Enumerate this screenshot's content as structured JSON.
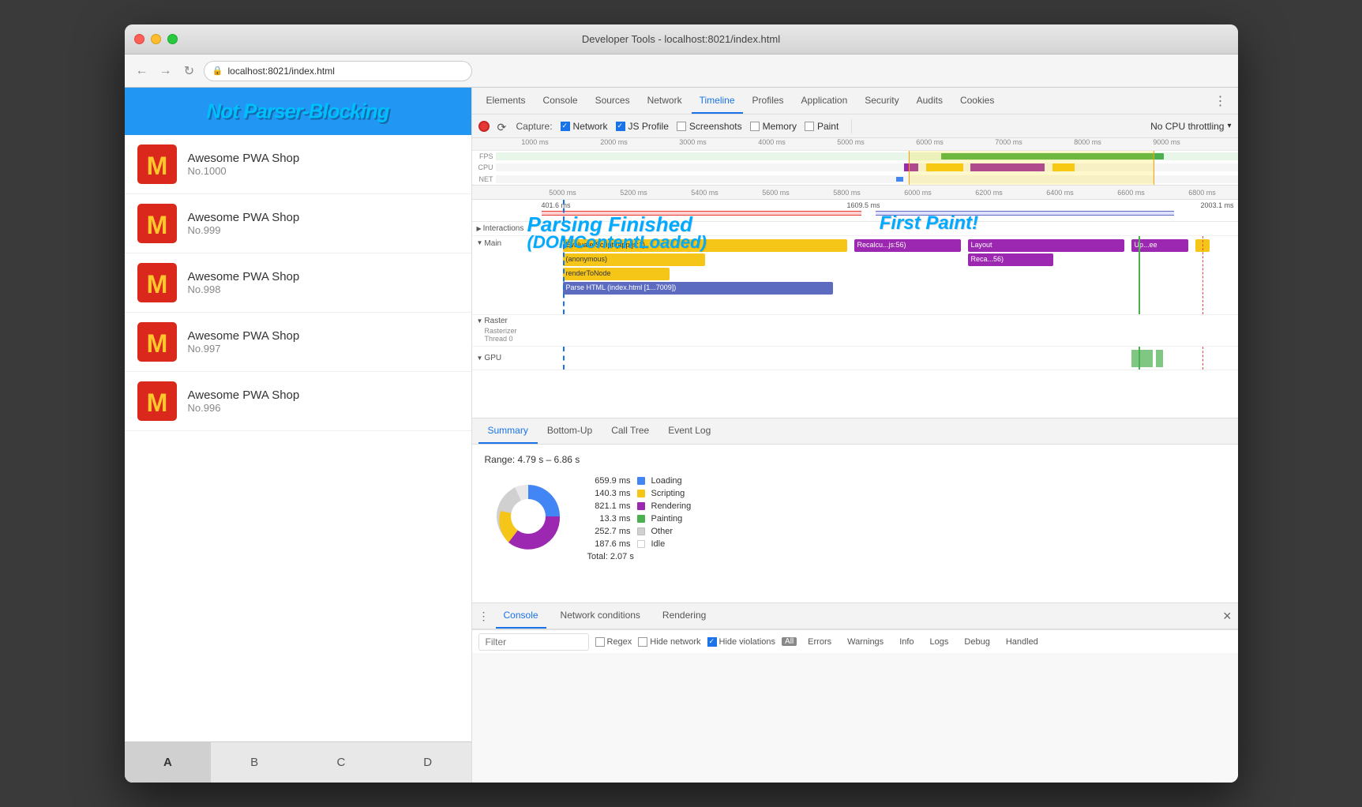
{
  "window": {
    "title": "Developer Tools - localhost:8021/index.html",
    "traffic_lights": [
      "close",
      "minimize",
      "maximize"
    ]
  },
  "browser": {
    "url": "localhost:8021/index.html",
    "back_label": "←",
    "forward_label": "→",
    "reload_label": "↻"
  },
  "webpage": {
    "header_annotation": "Not Parser-Blocking",
    "shop_items": [
      {
        "name": "Awesome PWA Shop",
        "number": "No.1000"
      },
      {
        "name": "Awesome PWA Shop",
        "number": "No.999"
      },
      {
        "name": "Awesome PWA Shop",
        "number": "No.998"
      },
      {
        "name": "Awesome PWA Shop",
        "number": "No.997"
      },
      {
        "name": "Awesome PWA Shop",
        "number": "No.996"
      }
    ],
    "tabs": [
      "A",
      "B",
      "C",
      "D"
    ],
    "active_tab": "A"
  },
  "devtools": {
    "tabs": [
      "Elements",
      "Console",
      "Sources",
      "Network",
      "Timeline",
      "Profiles",
      "Application",
      "Security",
      "Audits",
      "Cookies"
    ],
    "active_tab": "Timeline",
    "more_label": "⋮",
    "capture": {
      "label": "Capture:",
      "options": [
        "Network",
        "JS Profile",
        "Screenshots",
        "Memory",
        "Paint"
      ],
      "checked": [
        "Network",
        "JS Profile",
        "Hide violations"
      ]
    },
    "cpu_throttle": "No CPU throttling",
    "scale_marks": [
      "1000 ms",
      "2000 ms",
      "3000 ms",
      "4000 ms",
      "5000 ms",
      "6000 ms",
      "7000 ms",
      "8000 ms",
      "9000 ms"
    ],
    "detail_scale_marks": [
      "5000 ms",
      "5200 ms",
      "5400 ms",
      "5600 ms",
      "5800 ms",
      "6000 ms",
      "6200 ms",
      "6400 ms",
      "6600 ms",
      "6800 ms"
    ],
    "timing_bars": {
      "top_label": "401.6 ms",
      "mid_label": "1609.5 ms",
      "bottom_label": "2003.1 ms"
    },
    "interactions_label": "Interactions",
    "main_label": "Main",
    "raster_label": "Raster",
    "rasterizer_label": "Rasterizer Thread 0",
    "gpu_label": "GPU",
    "tasks": [
      {
        "label": "Evaluate Script (app.js:1)",
        "color": "#f5c518",
        "type": "scripting"
      },
      {
        "label": "(anonymous)",
        "color": "#f5c518",
        "type": "scripting"
      },
      {
        "label": "renderToNode",
        "color": "#f5c518",
        "type": "scripting"
      },
      {
        "label": "Parse HTML (index.html [1...7009])",
        "color": "#6a5acd",
        "type": "parsing"
      },
      {
        "label": "Recalcu...js:56)",
        "color": "#9c27b0",
        "type": "rendering"
      },
      {
        "label": "Layout",
        "color": "#9c27b0",
        "type": "rendering"
      },
      {
        "label": "Reca...56)",
        "color": "#9c27b0",
        "type": "rendering"
      },
      {
        "label": "Up...ee",
        "color": "#9c27b0",
        "type": "rendering"
      }
    ],
    "annotations": {
      "first_paint": "First Paint!",
      "parsing_finished": "Parsing Finished",
      "dom_content_loaded": "(DOMContentLoaded)"
    }
  },
  "summary": {
    "tab_label": "Summary",
    "range": "Range: 4.79 s – 6.86 s",
    "total": "Total: 2.07 s",
    "items": [
      {
        "label": "Loading",
        "time": "659.9 ms",
        "color": "#4285f4"
      },
      {
        "label": "Scripting",
        "time": "140.3 ms",
        "color": "#f5c518"
      },
      {
        "label": "Rendering",
        "time": "821.1 ms",
        "color": "#9c27b0"
      },
      {
        "label": "Painting",
        "time": "13.3 ms",
        "color": "#4caf50"
      },
      {
        "label": "Other",
        "time": "252.7 ms",
        "color": "#d0d0d0"
      },
      {
        "label": "Idle",
        "time": "187.6 ms",
        "color": "#ffffff"
      }
    ]
  },
  "bottom_tabs": [
    "Bottom-Up",
    "Call Tree",
    "Event Log"
  ],
  "console_tabs": [
    "Console",
    "Network conditions",
    "Rendering"
  ],
  "active_console_tab": "Console",
  "filter": {
    "placeholder": "Filter",
    "regex_label": "Regex",
    "hide_network_label": "Hide network",
    "hide_violations_label": "Hide violations",
    "levels": [
      "Errors",
      "Warnings",
      "Info",
      "Logs",
      "Debug",
      "Handled"
    ]
  }
}
